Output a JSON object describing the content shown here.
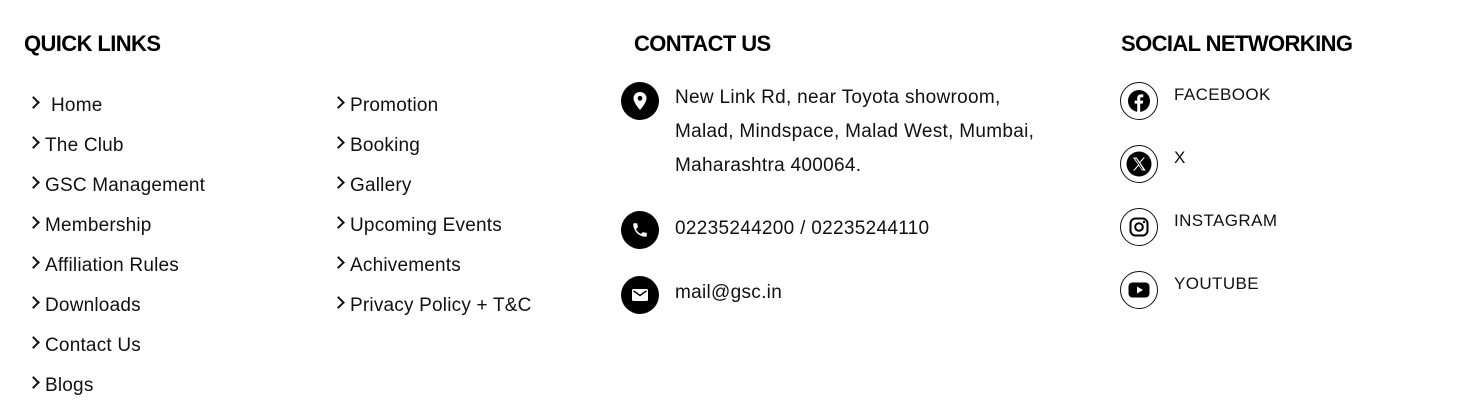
{
  "quick_links": {
    "heading": "QUICK LINKS",
    "column1": [
      {
        "label": "Home"
      },
      {
        "label": "The Club"
      },
      {
        "label": "GSC Management"
      },
      {
        "label": "Membership"
      },
      {
        "label": "Affiliation Rules"
      },
      {
        "label": "Downloads"
      },
      {
        "label": "Contact Us"
      },
      {
        "label": "Blogs"
      }
    ],
    "column2": [
      {
        "label": "Promotion"
      },
      {
        "label": "Booking"
      },
      {
        "label": "Gallery"
      },
      {
        "label": "Upcoming Events"
      },
      {
        "label": "Achivements"
      },
      {
        "label": "Privacy Policy + T&C"
      }
    ]
  },
  "contact": {
    "heading": "CONTACT US",
    "address_line1": "New Link Rd, near Toyota showroom,",
    "address_line2": "Malad, Mindspace, Malad West, Mumbai,",
    "address_line3": "Maharashtra 400064.",
    "phone": "02235244200 / 02235244110",
    "email": "mail@gsc.in",
    "icons": {
      "address": "location-pin-icon",
      "phone": "phone-icon",
      "email": "envelope-icon"
    }
  },
  "social": {
    "heading": "SOCIAL NETWORKING",
    "items": [
      {
        "label": "FACEBOOK",
        "icon": "facebook-icon"
      },
      {
        "label": "X",
        "icon": "x-icon"
      },
      {
        "label": "INSTAGRAM",
        "icon": "instagram-icon"
      },
      {
        "label": "YOUTUBE",
        "icon": "youtube-icon"
      }
    ]
  },
  "colors": {
    "text": "#111111",
    "icon_background": "#000000",
    "page_background": "#ffffff"
  }
}
